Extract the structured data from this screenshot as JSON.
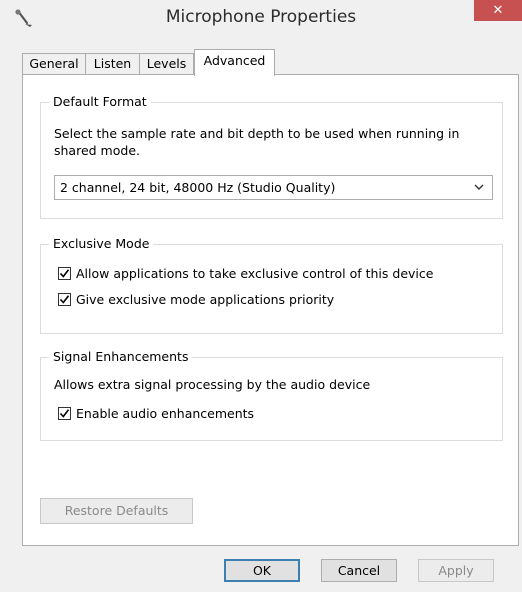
{
  "window": {
    "title": "Microphone Properties",
    "close_glyph": "✕"
  },
  "tabs": [
    {
      "label": "General",
      "active": false
    },
    {
      "label": "Listen",
      "active": false
    },
    {
      "label": "Levels",
      "active": false
    },
    {
      "label": "Advanced",
      "active": true
    }
  ],
  "default_format": {
    "group_label": "Default Format",
    "description": "Select the sample rate and bit depth to be used when running in shared mode.",
    "selected": "2 channel, 24 bit, 48000 Hz (Studio Quality)"
  },
  "exclusive_mode": {
    "group_label": "Exclusive Mode",
    "allow_exclusive": {
      "label": "Allow applications to take exclusive control of this device",
      "checked": true
    },
    "priority": {
      "label": "Give exclusive mode applications priority",
      "checked": true
    }
  },
  "signal_enhancements": {
    "group_label": "Signal Enhancements",
    "description": "Allows extra signal processing by the audio device",
    "enable": {
      "label": "Enable audio enhancements",
      "checked": true
    }
  },
  "buttons": {
    "restore_defaults": "Restore Defaults",
    "ok": "OK",
    "cancel": "Cancel",
    "apply": "Apply"
  },
  "icons": {
    "title_icon": "microphone-icon",
    "dropdown": "chevron-down-icon",
    "check": "checkmark-icon"
  }
}
